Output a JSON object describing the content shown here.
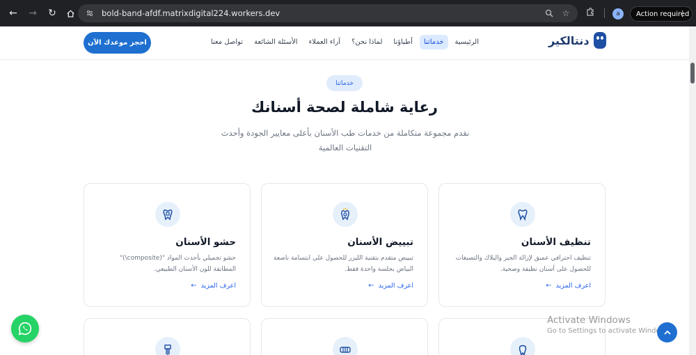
{
  "browser": {
    "url": "bold-band-afdf.matrixdigital224.workers.dev",
    "profile_initial": "a",
    "action_label": "Action required",
    "icons": [
      "back-arrow-icon",
      "forward-arrow-icon",
      "reload-icon",
      "home-icon",
      "site-info-icon",
      "zoom-icon",
      "star-icon",
      "extensions-icon",
      "more-vert-icon"
    ]
  },
  "header": {
    "logo_text": "دنتالكير",
    "nav": [
      {
        "label": "الرئيسية",
        "active": false
      },
      {
        "label": "خدماتنا",
        "active": true
      },
      {
        "label": "أطباؤنا",
        "active": false
      },
      {
        "label": "لماذا نحن؟",
        "active": false
      },
      {
        "label": "آراء العملاء",
        "active": false
      },
      {
        "label": "الأسئلة الشائعة",
        "active": false
      },
      {
        "label": "تواصل معنا",
        "active": false
      }
    ],
    "cta_label": "احجز موعدك الآن"
  },
  "hero": {
    "badge": "خدماتنا",
    "title": "رعاية شاملة لصحة أسنانك",
    "subtitle": "نقدم مجموعة متكاملة من خدمات طب الأسنان بأعلى معايير الجودة وأحدث التقنيات العالمية"
  },
  "services": [
    {
      "title": "تنظيف الأسنان",
      "description": "تنظيف احترافي عميق لإزالة الجير والبلاك والتصبغات للحصول على أسنان نظيفة وصحية.",
      "link": "اعرف المزيد",
      "icon": "tooth-icon"
    },
    {
      "title": "تبييض الأسنان",
      "description": "تبييض متقدم بتقنية الليزر للحصول على ابتسامة ناصعة البياض بجلسة واحدة فقط.",
      "link": "اعرف المزيد",
      "icon": "whitening-icon"
    },
    {
      "title": "حشو الأسنان",
      "description": "حشو تجميلي بأحدث المواد \"(composite\\)\" المطابقة للون الأسنان الطبيعي.",
      "link": "اعرف المزيد",
      "icon": "filling-icon"
    }
  ],
  "partial_icons": [
    "implant-icon",
    "braces-icon",
    "crown-icon"
  ],
  "watermark": {
    "title": "Activate Windows",
    "subtitle": "Go to Settings to activate Windows."
  },
  "colors": {
    "primary": "#1e6fd0",
    "badge_bg": "#e0ecfb",
    "whatsapp": "#25d366"
  }
}
